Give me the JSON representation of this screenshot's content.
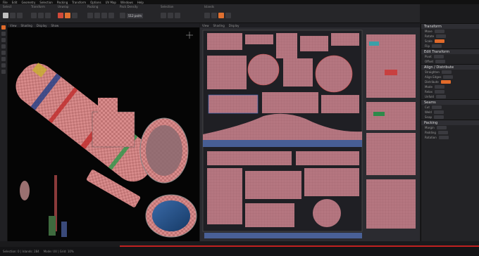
{
  "menu": [
    "File",
    "Edit",
    "Geometry",
    "Selection",
    "Packing",
    "Transform",
    "Options",
    "UV Map",
    "Windows",
    "Help"
  ],
  "toolbar": {
    "groups": [
      "Select",
      "Transform",
      "Unwrap",
      "Packing",
      "Pack Density",
      "Selection",
      "Islands"
    ],
    "pack_density_value": "512 px/m"
  },
  "viewport": {
    "tabs": [
      "View",
      "Shading",
      "Display",
      "Show"
    ],
    "label": "3D"
  },
  "uv": {
    "tabs": [
      "View",
      "Shading",
      "Display"
    ],
    "label": "UV"
  },
  "right_panel": {
    "sections": [
      {
        "title": "Transform",
        "rows": [
          "Move",
          "Rotate",
          "Scale",
          "Flip"
        ]
      },
      {
        "title": "Edit Transform",
        "rows": [
          "Pivot",
          "Offset"
        ]
      },
      {
        "title": "Align / Distribute",
        "rows": [
          "Straighten",
          "Align Edges",
          "Distribute",
          "Mode",
          "Relax",
          "Unfold"
        ]
      },
      {
        "title": "Seams",
        "rows": [
          "Cut",
          "Weld",
          "Snap"
        ]
      },
      {
        "title": "Packing",
        "rows": [
          "Margin",
          "Padding",
          "Rotation"
        ]
      }
    ]
  },
  "status": {
    "left": "Selection: 0 | Islands: 284",
    "right": "Mode: UV | Grid: 10%"
  },
  "colors": {
    "accent": "#e06a2a",
    "uv_island": "#c9858a",
    "uv_bg": "#2b2b30"
  }
}
